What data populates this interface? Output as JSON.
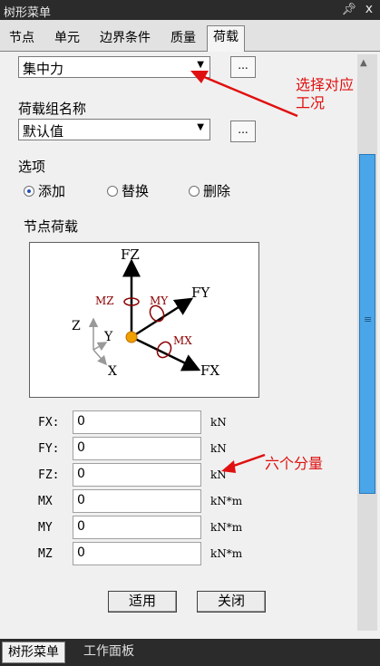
{
  "window": {
    "title": "树形菜单",
    "pin_icon": "pin-icon",
    "close_glyph": "x"
  },
  "tabs": [
    "节点",
    "单元",
    "边界条件",
    "质量",
    "荷载"
  ],
  "active_tab": 4,
  "load_type": {
    "value": "集中力",
    "more": "..."
  },
  "group": {
    "label": "荷载组名称",
    "value": "默认值",
    "more": "..."
  },
  "options": {
    "label": "选项",
    "items": [
      "添加",
      "替换",
      "删除"
    ],
    "selected": 0
  },
  "node_load": {
    "label": "节点荷载",
    "diagram": {
      "fz": "FZ",
      "fy": "FY",
      "fx": "FX",
      "mz": "MZ",
      "my": "MY",
      "mx": "MX",
      "z": "Z",
      "y": "Y",
      "x": "X"
    }
  },
  "fields": [
    {
      "label": "FX:",
      "value": "0",
      "unit": "kN"
    },
    {
      "label": "FY:",
      "value": "0",
      "unit": "kN"
    },
    {
      "label": "FZ:",
      "value": "0",
      "unit": "kN"
    },
    {
      "label": "MX",
      "value": "0",
      "unit": "kN*m"
    },
    {
      "label": "MY",
      "value": "0",
      "unit": "kN*m"
    },
    {
      "label": "MZ",
      "value": "0",
      "unit": "kN*m"
    }
  ],
  "buttons": {
    "apply": "适用",
    "close": "关闭"
  },
  "bottom_tabs": [
    "树形菜单",
    "工作面板"
  ],
  "annotations": {
    "a1_line1": "选择对应",
    "a1_line2": "工况",
    "a2": "六个分量"
  },
  "colors": {
    "annotation": "#e01010",
    "scroll_thumb": "#4aa6e8",
    "moment": "#8b0000"
  }
}
